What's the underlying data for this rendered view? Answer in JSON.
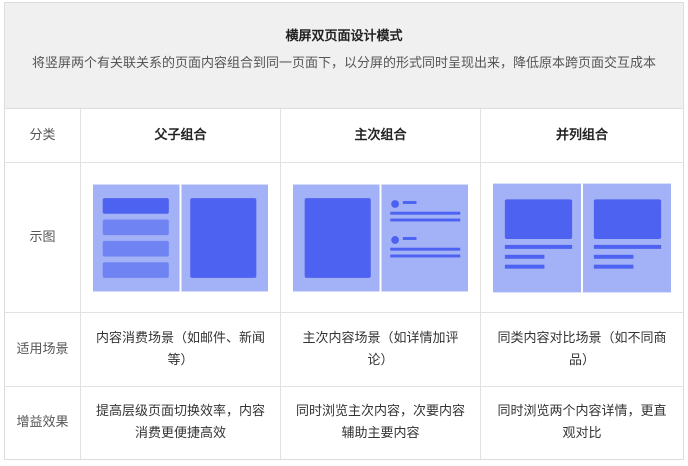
{
  "header": {
    "title": "横屏双页面设计模式",
    "description": "将竖屏两个有关联关系的页面内容组合到同一页面下，以分屏的形式同时呈现出来，降低原本跨页面交互成本"
  },
  "rows": {
    "category": {
      "label": "分类",
      "col1": "父子组合",
      "col2": "主次组合",
      "col3": "并列组合"
    },
    "diagram": {
      "label": "示图"
    },
    "scenario": {
      "label": "适用场景",
      "col1": "内容消费场景（如邮件、新闻等）",
      "col2": "主次内容场景（如详情加评论）",
      "col3": "同类内容对比场景（如不同商品）"
    },
    "benefit": {
      "label": "增益效果",
      "col1": "提高层级页面切换效率，内容消费更便捷高效",
      "col2": "同时浏览主次内容，次要内容辅助主要内容",
      "col3": "同时浏览两个内容详情，更直观对比"
    }
  },
  "colors": {
    "panel": "#a3b1f7",
    "block": "#4d62f0",
    "row_light": "#6f83f3",
    "header_bg": "#f0f0f0",
    "border": "#dcdcdc"
  }
}
